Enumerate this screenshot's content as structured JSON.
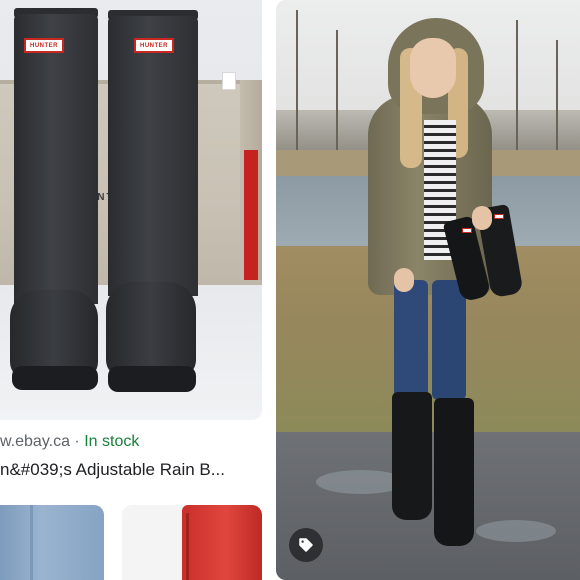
{
  "left_result": {
    "source": "w.ebay.ca",
    "separator": "·",
    "availability": "In stock",
    "title": "n&#039;s Adjustable Rain B...",
    "box_brand_text": "UNTE",
    "boot_logo_text": "HUNTER"
  },
  "right_result": {
    "tag_icon": "tag-icon"
  },
  "colors": {
    "source_gray": "#5f6368",
    "stock_green": "#188038",
    "title_text": "#202124",
    "logo_red": "#c8281f"
  }
}
